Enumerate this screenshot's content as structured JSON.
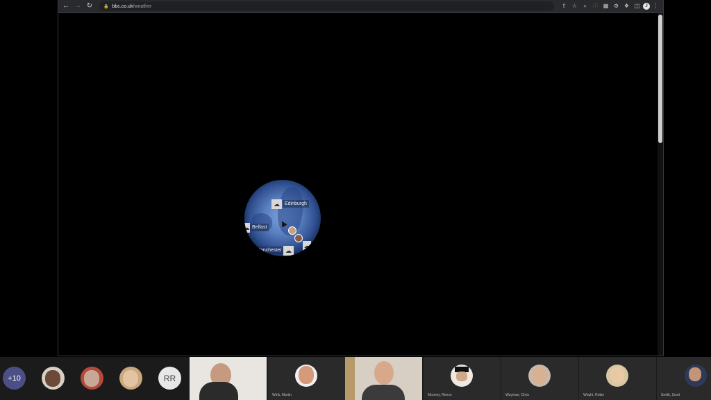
{
  "browser": {
    "url_host": "bbc.co.uk",
    "url_path": "/weather",
    "icons": {
      "back": "back-arrow-icon",
      "forward": "forward-arrow-icon",
      "reload": "reload-icon",
      "lock": "lock-icon",
      "share": "share-icon",
      "bookmark": "star-icon",
      "menu": "kebab-menu-icon"
    },
    "profile_initial": "J"
  },
  "map": {
    "locations": [
      {
        "name": "Edinburgh",
        "weather": "cloud-rain"
      },
      {
        "name": "Belfast",
        "weather": "cloud-rain"
      },
      {
        "name": "Manchester",
        "weather": "cloud"
      }
    ]
  },
  "participants": {
    "overflow_label": "+10",
    "initials_avatar": "RR",
    "tiles": [
      {
        "name": ""
      },
      {
        "name": "Wink, Martin"
      },
      {
        "name": ""
      },
      {
        "name": "Mooney, Reece"
      },
      {
        "name": "Wayman, Chris"
      },
      {
        "name": "Wright, Robin"
      },
      {
        "name": "Smith, Scott"
      }
    ]
  }
}
